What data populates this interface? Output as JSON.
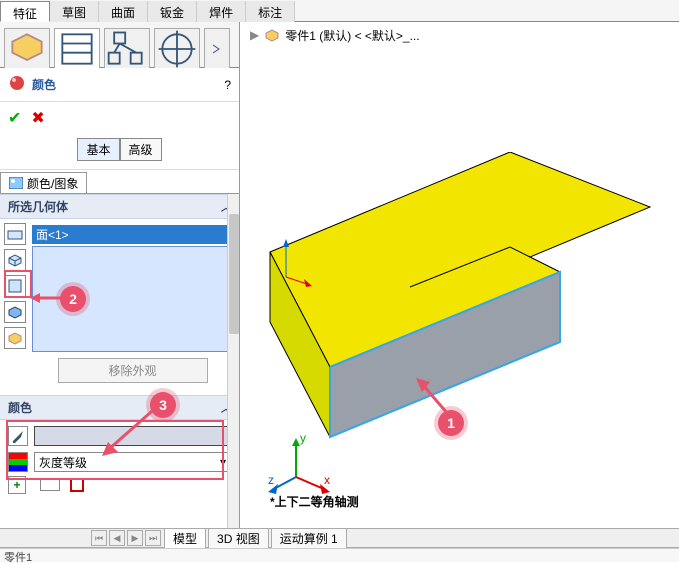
{
  "tabs": {
    "feature": "特征",
    "sketch": "草图",
    "surface": "曲面",
    "sheetmetal": "钣金",
    "weldment": "焊件",
    "annotation": "标注"
  },
  "crumb": {
    "part": "零件1 (默认) < <默认>_..."
  },
  "panel": {
    "title": "颜色",
    "basic": "基本",
    "advanced": "高级",
    "subtab": "颜色/图象",
    "geom_head": "所选几何体",
    "face_item": "面<1>",
    "remove": "移除外观",
    "color_head": "颜色",
    "grayscale": "灰度等级"
  },
  "callouts": {
    "c1": "1",
    "c2": "2",
    "c3": "3"
  },
  "view_label": "*上下二等角轴测",
  "bottom": {
    "model": "模型",
    "view3d": "3D 视图",
    "motion": "运动算例 1"
  },
  "status": "零件1",
  "axes": {
    "x": "x",
    "y": "y",
    "z": "z"
  }
}
